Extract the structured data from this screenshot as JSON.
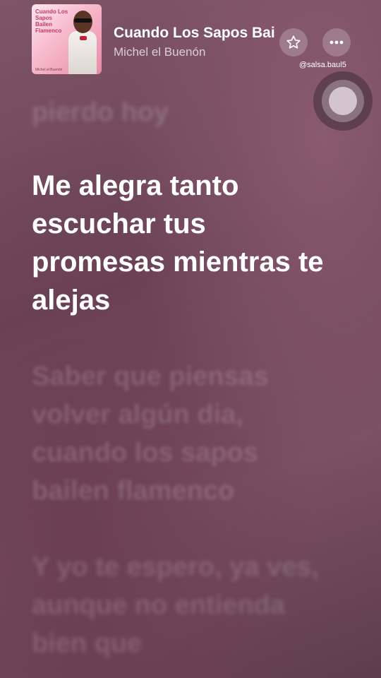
{
  "now_playing": {
    "album_cover": {
      "text": "Cuando Los Sapos Bailen Flamenco",
      "artist_credit": "Michel el Buenón"
    },
    "title": "Cuando Los Sapos Bailen Flamenco",
    "artist": "Michel el Buenón",
    "favorite_icon": "star-outline-icon",
    "more_icon": "ellipsis-icon"
  },
  "watermark": "@salsa.baul5",
  "lyrics": {
    "previous": "pierdo hoy",
    "current": "Me alegra tanto escuchar tus promesas mientras te alejas",
    "next": "Saber que piensas volver algún dia, cuando los sapos bailen flamenco",
    "next2": "Y yo te espero, ya ves, aunque no entienda bien que"
  }
}
